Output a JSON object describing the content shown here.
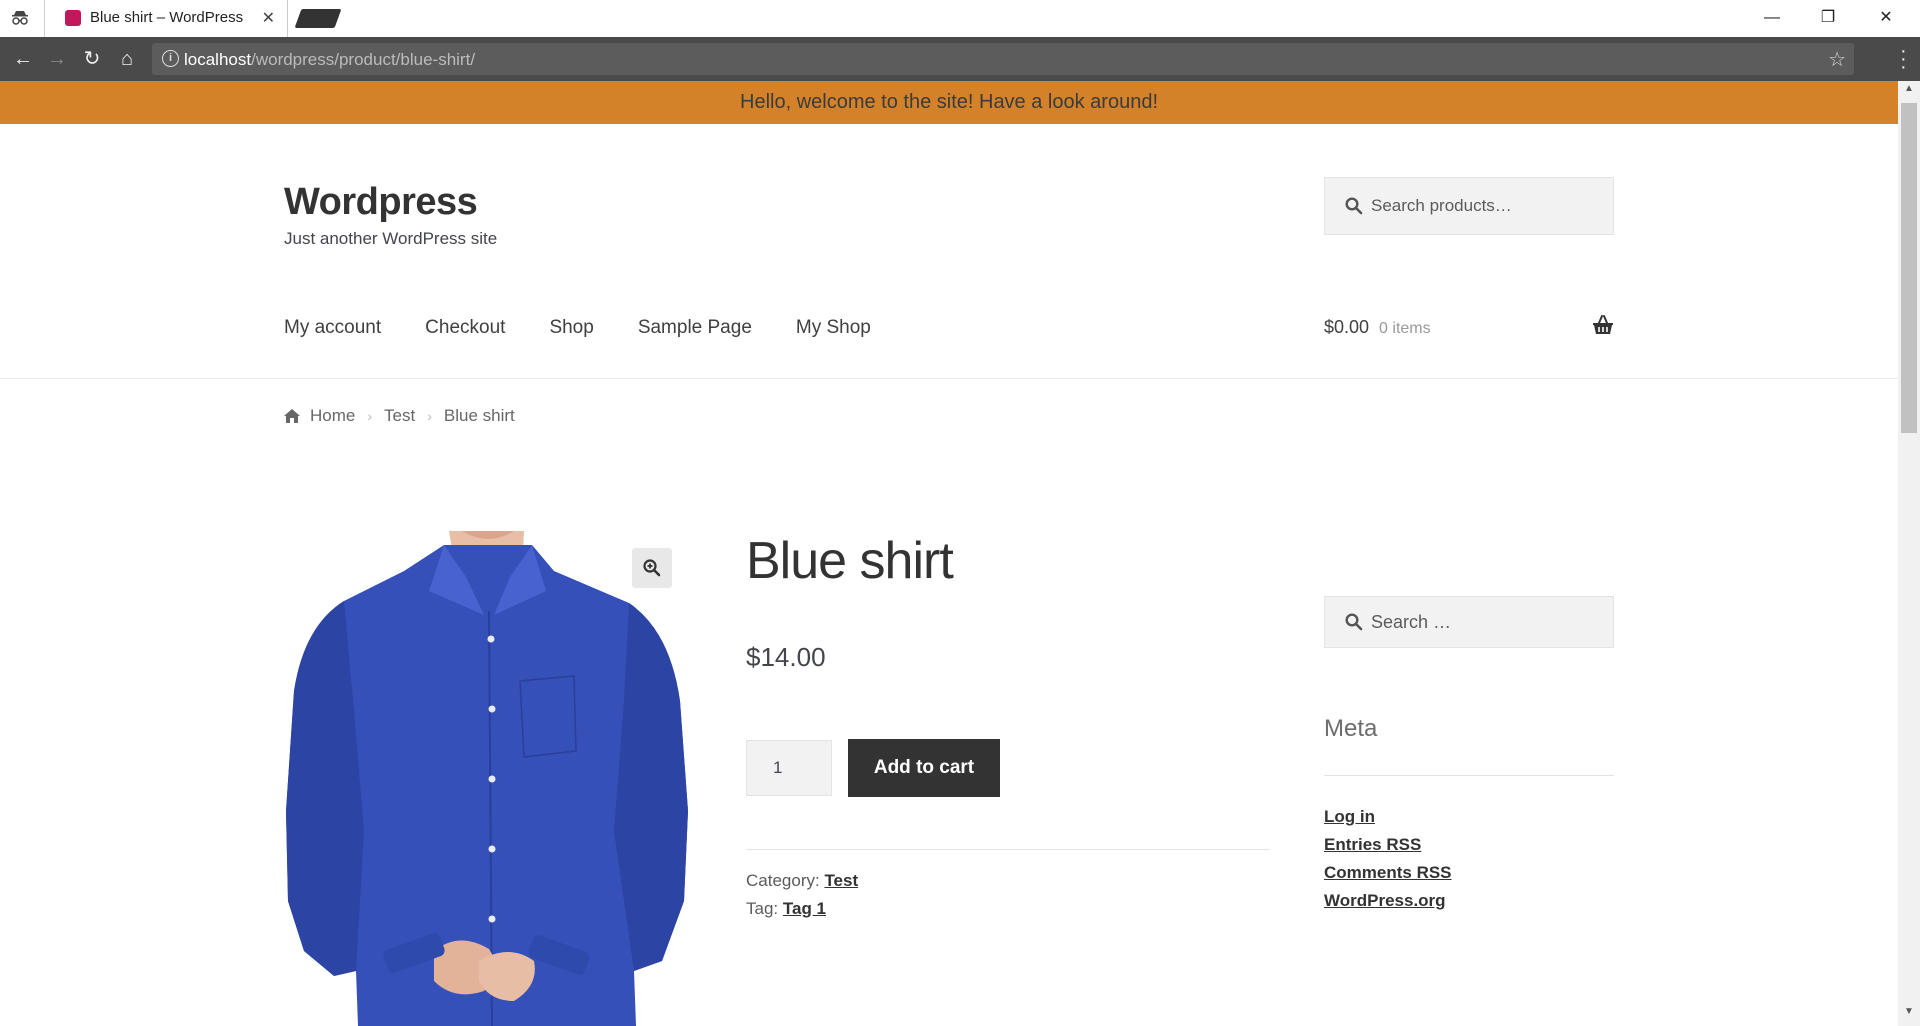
{
  "browser": {
    "tab_title": "Blue shirt – WordPress",
    "url_host": "localhost",
    "url_path": "/wordpress/product/blue-shirt/"
  },
  "notice": "Hello, welcome to the site! Have a look around!",
  "site": {
    "title": "Wordpress",
    "description": "Just another WordPress site",
    "search_placeholder": "Search products…"
  },
  "nav": {
    "items": [
      "My account",
      "Checkout",
      "Shop",
      "Sample Page",
      "My Shop"
    ]
  },
  "cart": {
    "amount": "$0.00",
    "count": "0 items"
  },
  "breadcrumb": {
    "home": "Home",
    "category": "Test",
    "current": "Blue shirt"
  },
  "product": {
    "title": "Blue shirt",
    "price": "$14.00",
    "quantity": "1",
    "add_to_cart": "Add to cart",
    "category_label": "Category:",
    "category": "Test",
    "tag_label": "Tag:",
    "tag": "Tag 1"
  },
  "sidebar": {
    "search_placeholder": "Search …",
    "meta_title": "Meta",
    "links": [
      "Log in",
      "Entries RSS",
      "Comments RSS",
      "WordPress.org"
    ]
  },
  "colors": {
    "notice_bg": "#d3822a",
    "shirt": "#3550b8",
    "button_bg": "#333333"
  }
}
